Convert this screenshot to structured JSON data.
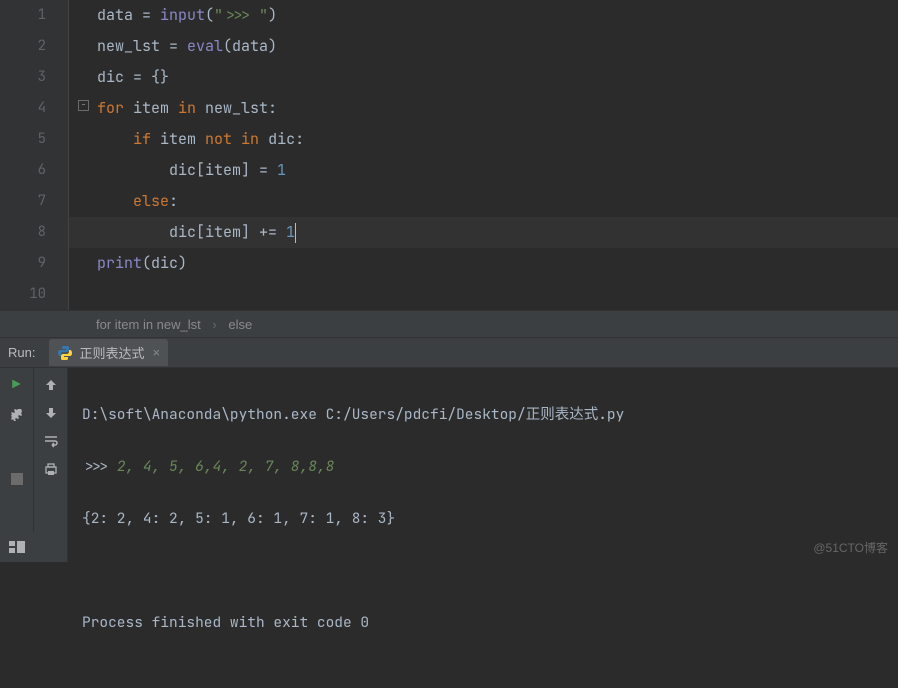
{
  "code": {
    "l1": {
      "a": "data = ",
      "b": "input",
      "c": "(",
      "d": "\">>> \"",
      "e": ")"
    },
    "l2": {
      "a": "new_lst = ",
      "b": "eval",
      "c": "(data)"
    },
    "l3": {
      "a": "dic = {}"
    },
    "l4": {
      "a": "for ",
      "b": "item ",
      "c": "in ",
      "d": "new_lst:"
    },
    "l5": {
      "a": "    ",
      "b": "if ",
      "c": "item ",
      "d": "not in ",
      "e": "dic:"
    },
    "l6": {
      "a": "        dic[item] = ",
      "b": "1"
    },
    "l7": {
      "a": "    ",
      "b": "else",
      "c": ":"
    },
    "l8": {
      "a": "        dic[item] += ",
      "b": "1"
    },
    "l9": {
      "a": "print",
      "b": "(dic)"
    }
  },
  "breadcrumb": {
    "item1": "for item in new_lst",
    "item2": "else"
  },
  "run": {
    "label": "Run:",
    "tab_name": "正则表达式"
  },
  "console": {
    "l1": "D:\\soft\\Anaconda\\python.exe C:/Users/pdcfi/Desktop/正则表达式.py",
    "l2_prompt": ">>> ",
    "l2_input": "2, 4, 5, 6,4, 2, 7, 8,8,8",
    "l3": "{2: 2, 4: 2, 5: 1, 6: 1, 7: 1, 8: 3}",
    "l4": "Process finished with exit code 0"
  },
  "watermark": "@51CTO博客"
}
